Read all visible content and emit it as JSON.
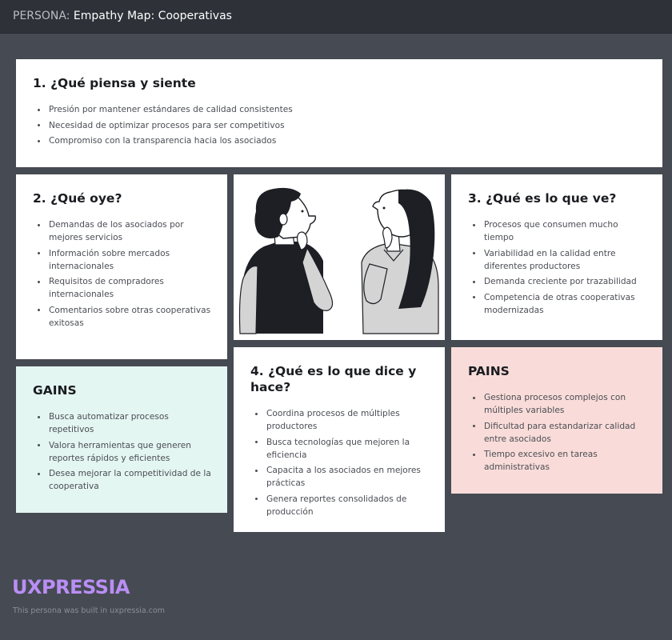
{
  "header": {
    "prefix": "PERSONA:",
    "title": "Empathy Map: Cooperativas"
  },
  "cards": {
    "thinks": {
      "title": "1. ¿Qué piensa y siente",
      "items": [
        "Presión por mantener estándares de calidad consistentes",
        "Necesidad de optimizar procesos para ser competitivos",
        "Compromiso con la transparencia hacia los asociados"
      ]
    },
    "hears": {
      "title": "2. ¿Qué oye?",
      "items": [
        "Demandas de los asociados por mejores servicios",
        "Información sobre mercados internacionales",
        "Requisitos de compradores internacionales",
        "Comentarios sobre otras cooperativas exitosas"
      ]
    },
    "sees": {
      "title": "3. ¿Qué es lo que ve?",
      "items": [
        "Procesos que consumen mucho tiempo",
        "Variabilidad en la calidad entre diferentes productores",
        "Demanda creciente por trazabilidad",
        "Competencia de otras cooperativas modernizadas"
      ]
    },
    "says": {
      "title": "4. ¿Qué es lo que dice y hace?",
      "items": [
        "Coordina procesos de múltiples productores",
        "Busca tecnologías que mejoren la eficiencia",
        "Capacita a los asociados en mejores prácticas",
        "Genera reportes consolidados de producción"
      ]
    },
    "gains": {
      "title": "GAINS",
      "items": [
        "Busca automatizar procesos repetitivos",
        "Valora herramientas que generen reportes rápidos y eficientes",
        "Desea mejorar la competitividad de la cooperativa"
      ]
    },
    "pains": {
      "title": "PAINS",
      "items": [
        "Gestiona procesos complejos con múltiples variables",
        "Dificultad para estandarizar calidad entre asociados",
        "Tiempo excesivo en tareas administrativas"
      ]
    }
  },
  "footer": {
    "brand": "UXPRESSIA",
    "note": "This persona was built in uxpressia.com"
  },
  "colors": {
    "background": "#464a52",
    "topbar": "#2e3138",
    "gains_bg": "#e4f6f2",
    "pains_bg": "#f9dcd9",
    "brand": "#b98ef5"
  }
}
